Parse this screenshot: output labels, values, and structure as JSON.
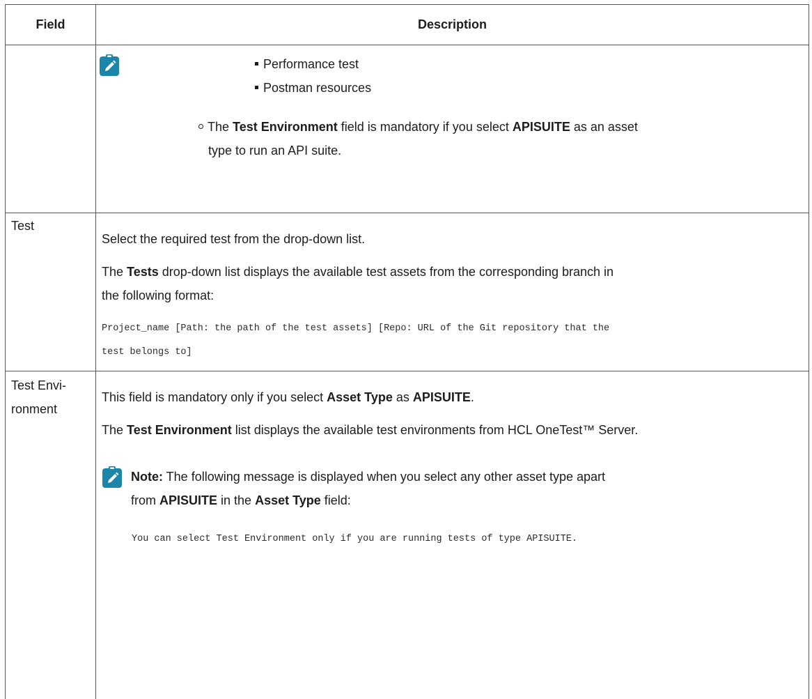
{
  "header": {
    "field": "Field",
    "description": "Description"
  },
  "row_continued": {
    "sub_bullets": [
      "Performance test",
      "Postman resources"
    ],
    "circle_item": {
      "pre": "The ",
      "b1": "Test Environment",
      "mid": " field is mandatory if you select ",
      "b2": "APISUITE",
      "post1": " as an asset",
      "post2": "type to run an API suite."
    }
  },
  "row_test": {
    "field": "Test",
    "p1": "Select the required test from the drop-down list.",
    "p2_pre": "The ",
    "p2_b": "Tests",
    "p2_post1": " drop-down list displays the available test assets from the corresponding branch in",
    "p2_post2": "the following format:",
    "code1": "Project_name [Path: the path of the test assets] [Repo: URL of the Git repository that the",
    "code2": "test belongs to]"
  },
  "row_env": {
    "field1": "Test Envi-",
    "field2": "ronment",
    "p1_pre": "This field is mandatory only if you select ",
    "p1_b1": "Asset Type",
    "p1_mid": " as ",
    "p1_b2": "APISUITE",
    "p1_post": ".",
    "p2_pre": "The ",
    "p2_b": "Test Environment",
    "p2_post": " list displays the available test environments from HCL OneTest™ Server.",
    "note_label": "Note:",
    "note_text1": " The following message is displayed when you select any other asset type apart",
    "note_pre2": "from ",
    "note_b2": "APISUITE",
    "note_mid2": " in the ",
    "note_b3": "Asset Type",
    "note_post2": " field:",
    "code": "You can select Test Environment only if you are running tests of type APISUITE."
  },
  "colors": {
    "icon": "#1a87a8",
    "border": "#555555",
    "text": "#1d1d1d"
  }
}
